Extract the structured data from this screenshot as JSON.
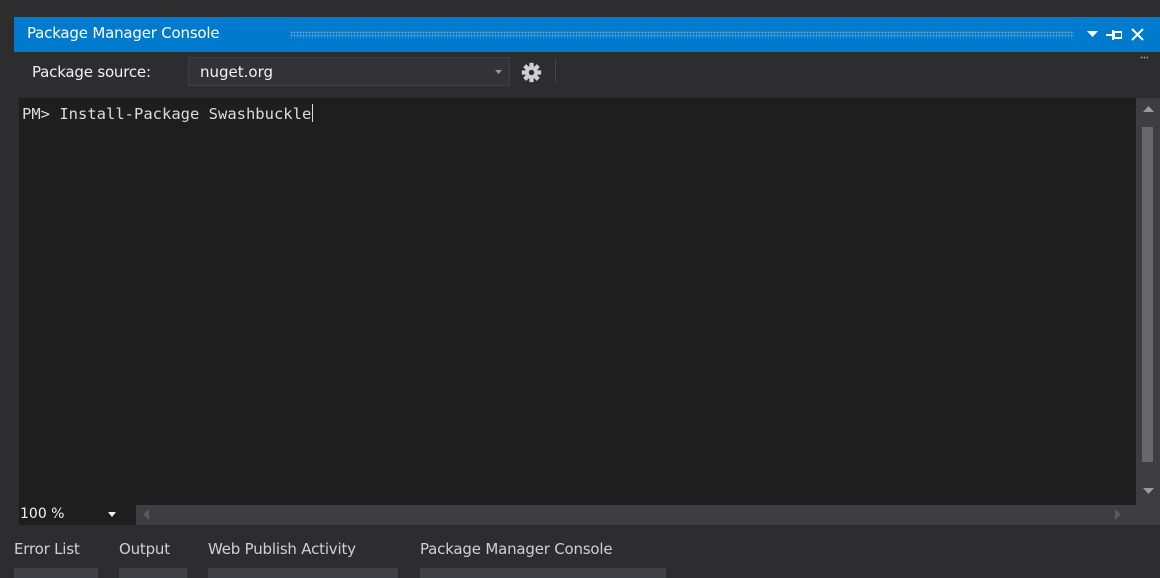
{
  "window": {
    "title": "Package Manager Console"
  },
  "toolbar": {
    "package_source_label": "Package source:",
    "package_source_value": "nuget.org"
  },
  "console": {
    "prompt": "PM>",
    "command": "Install-Package Swashbuckle"
  },
  "status": {
    "zoom": "100 %"
  },
  "tabs": [
    {
      "label": "Error List"
    },
    {
      "label": "Output"
    },
    {
      "label": "Web Publish Activity"
    },
    {
      "label": "Package Manager Console"
    }
  ],
  "icons": {
    "dropdown": "chevron-down-icon",
    "pin": "pin-icon",
    "close": "close-icon",
    "settings": "gear-icon",
    "scroll_up": "scroll-up-icon",
    "scroll_down": "scroll-down-icon",
    "scroll_left": "scroll-left-icon",
    "scroll_right": "scroll-right-icon"
  },
  "colors": {
    "accent": "#007acc",
    "background": "#2d2d30",
    "console_background": "#1e1e1e",
    "text": "#f1f1f1"
  }
}
